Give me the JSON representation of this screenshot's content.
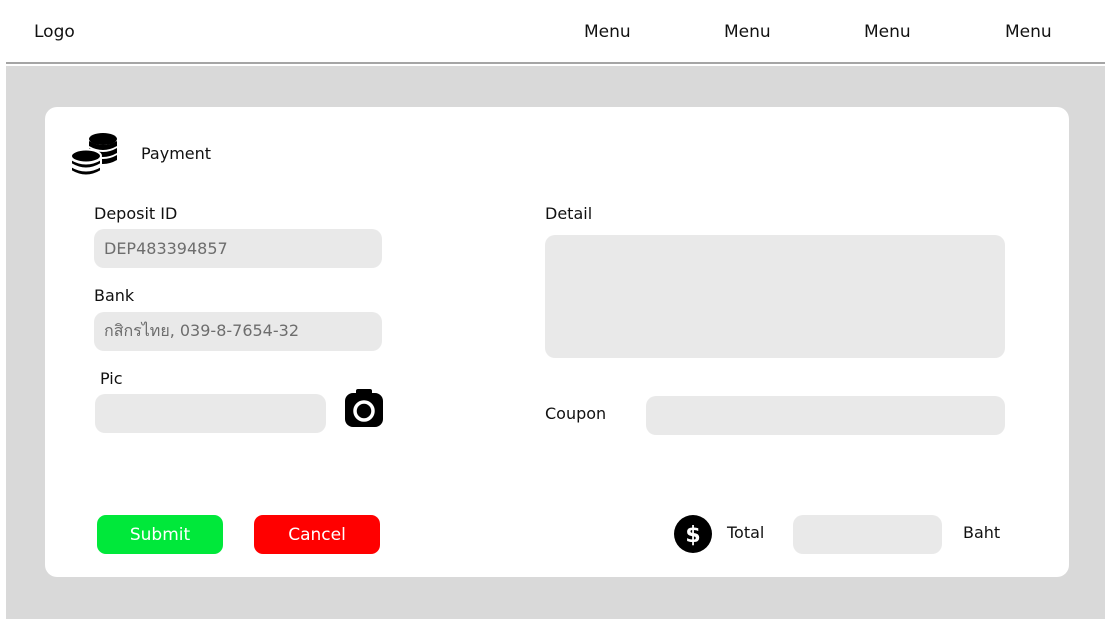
{
  "navbar": {
    "logo": "Logo",
    "menus": [
      "Menu",
      "Menu",
      "Menu",
      "Menu"
    ]
  },
  "payment": {
    "title": "Payment",
    "title_icon": "coins-icon",
    "deposit_id": {
      "label": "Deposit ID",
      "value": "DEP483394857"
    },
    "bank": {
      "label": "Bank",
      "value": "กสิกรไทย, 039-8-7654-32"
    },
    "pic": {
      "label": "Pic",
      "value": "",
      "icon": "camera-icon"
    },
    "detail": {
      "label": "Detail",
      "value": ""
    },
    "coupon": {
      "label": "Coupon",
      "value": ""
    },
    "total": {
      "label": "Total",
      "value": "",
      "unit": "Baht",
      "icon": "dollar-icon"
    }
  },
  "actions": {
    "submit_label": "Submit",
    "cancel_label": "Cancel"
  },
  "colors": {
    "submit": "#00e83a",
    "cancel": "#ff0000",
    "page_bg": "#d9d9d9",
    "field_bg": "#e9e9e9"
  }
}
